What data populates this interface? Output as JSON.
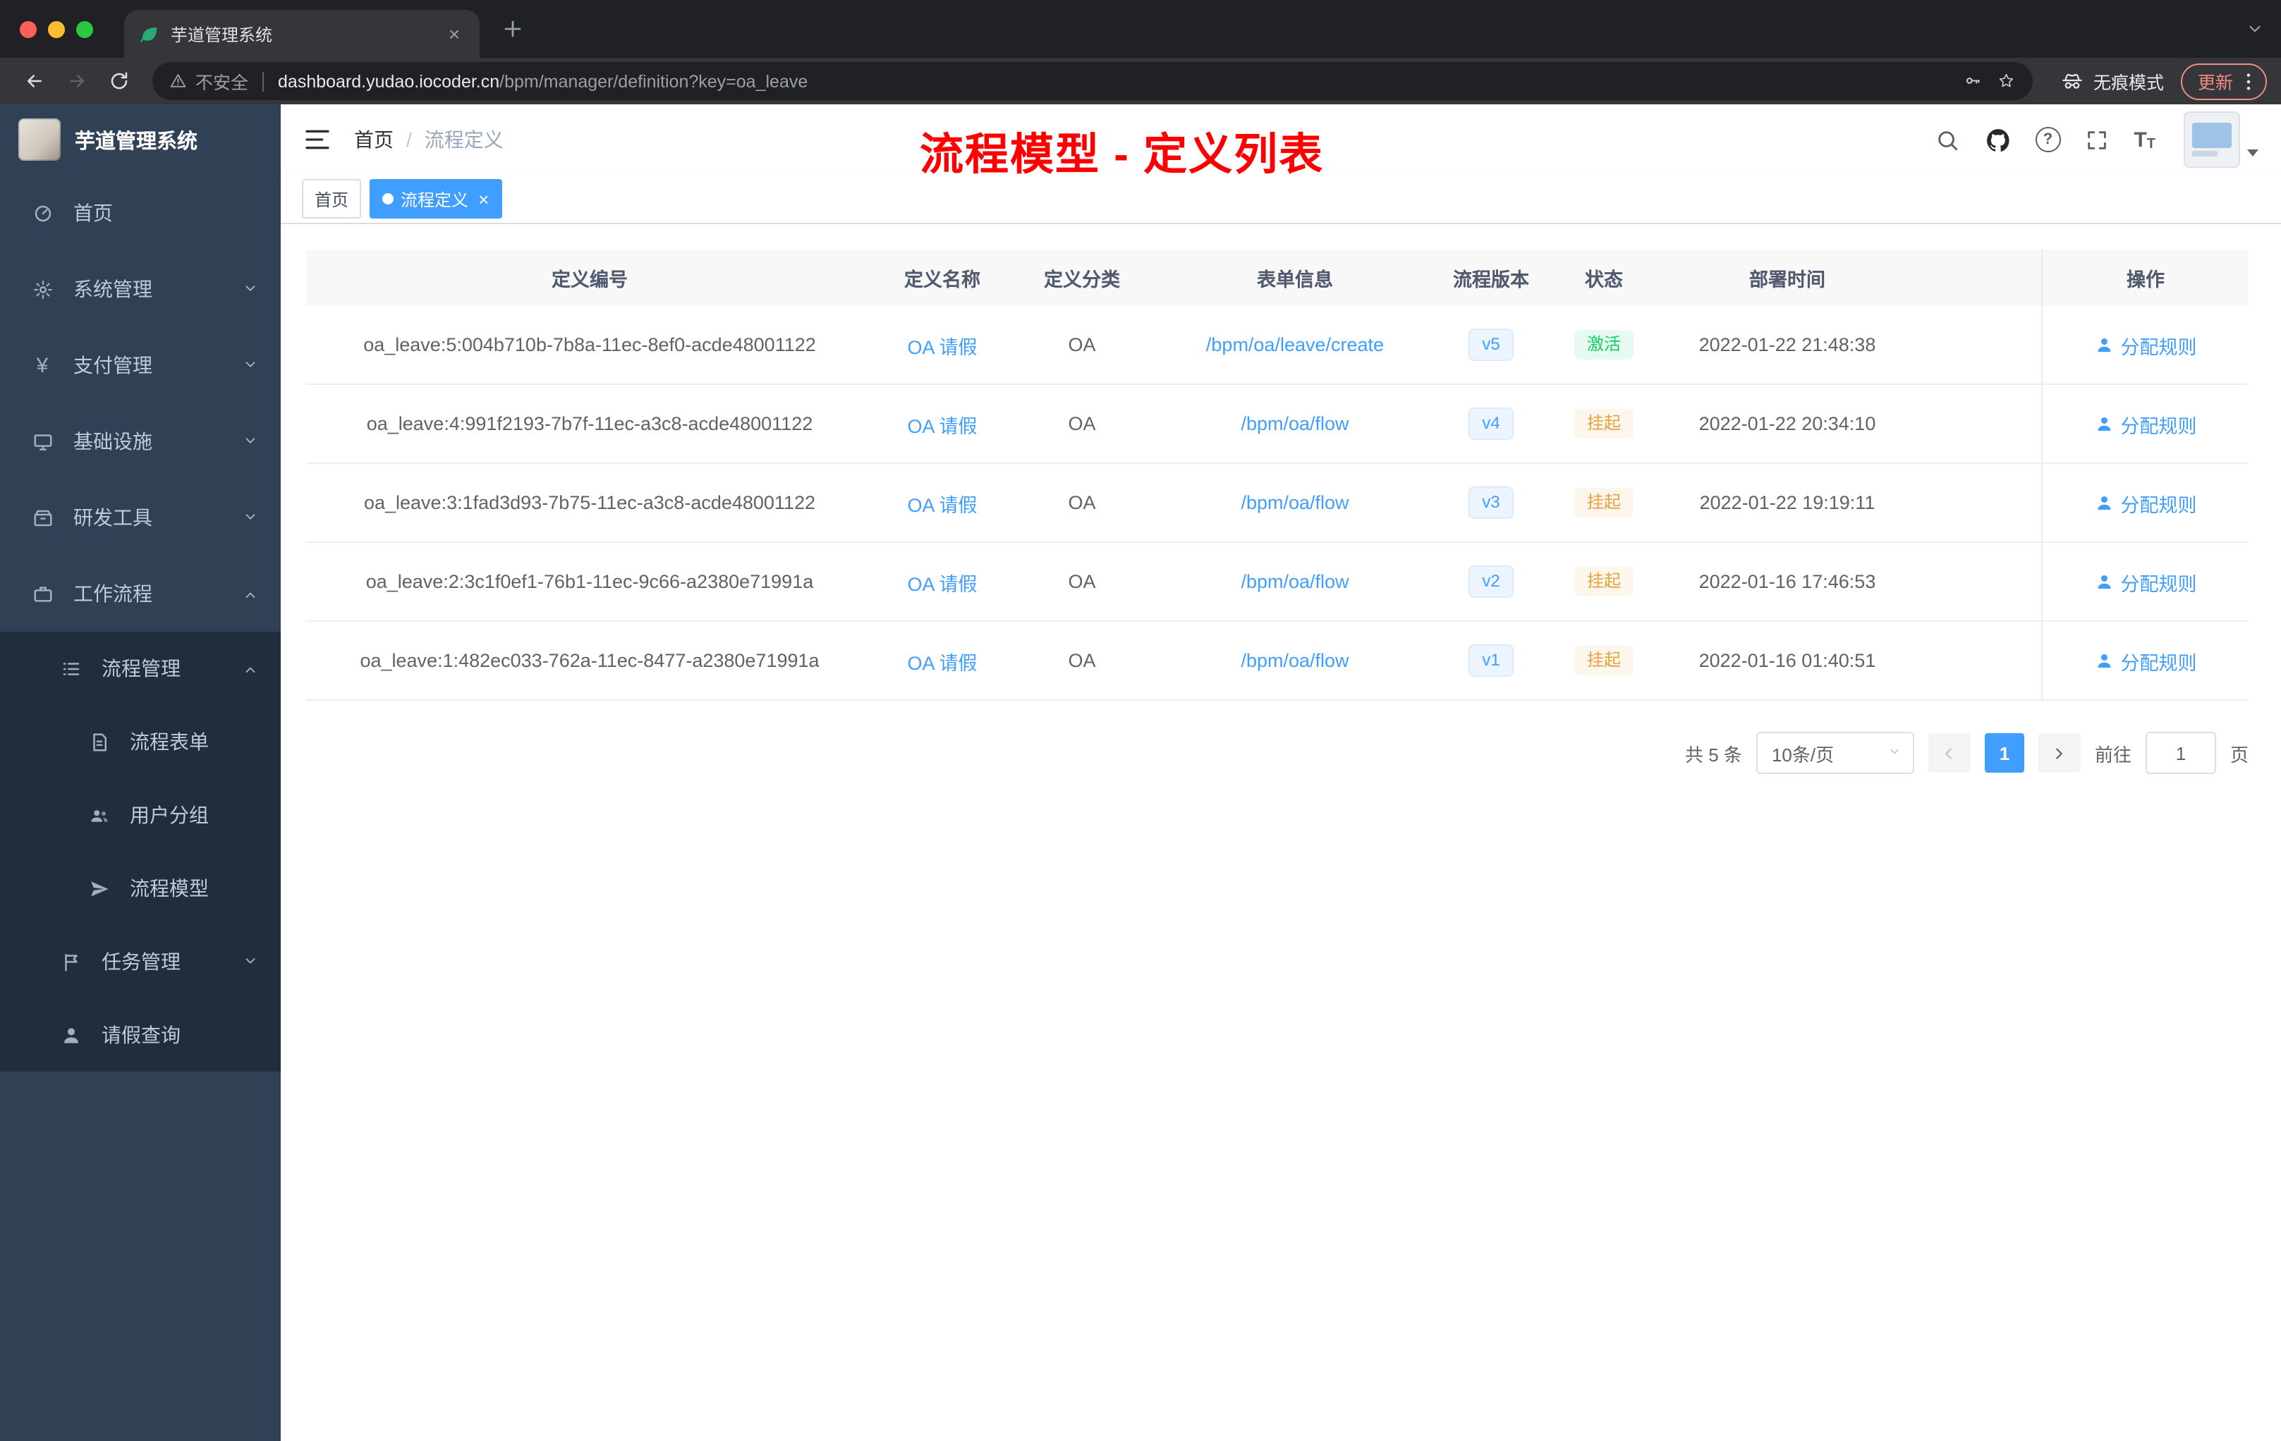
{
  "browser": {
    "tab_title": "芋道管理系统",
    "security_label": "不安全",
    "url_host": "dashboard.yudao.iocoder.cn",
    "url_path": "/bpm/manager/definition?key=oa_leave",
    "incognito_label": "无痕模式",
    "update_label": "更新"
  },
  "sidebar": {
    "logo_title": "芋道管理系统",
    "items": [
      {
        "label": "首页"
      },
      {
        "label": "系统管理"
      },
      {
        "label": "支付管理"
      },
      {
        "label": "基础设施"
      },
      {
        "label": "研发工具"
      },
      {
        "label": "工作流程"
      },
      {
        "label": "流程管理"
      },
      {
        "label": "流程表单"
      },
      {
        "label": "用户分组"
      },
      {
        "label": "流程模型"
      },
      {
        "label": "任务管理"
      },
      {
        "label": "请假查询"
      }
    ]
  },
  "header": {
    "breadcrumb_home": "首页",
    "breadcrumb_separator": "/",
    "breadcrumb_current": "流程定义",
    "annotation": "流程模型 - 定义列表"
  },
  "icons": {
    "help_glyph": "?",
    "font_large": "T",
    "font_small": "T"
  },
  "tags": {
    "home": "首页",
    "active": "流程定义"
  },
  "table": {
    "columns": {
      "id": "定义编号",
      "name": "定义名称",
      "category": "定义分类",
      "form": "表单信息",
      "version": "流程版本",
      "status": "状态",
      "time": "部署时间",
      "action": "操作"
    },
    "rows": [
      {
        "id": "oa_leave:5:004b710b-7b8a-11ec-8ef0-acde48001122",
        "name": "OA 请假",
        "category": "OA",
        "form": "/bpm/oa/leave/create",
        "version": "v5",
        "status": "激活",
        "time": "2022-01-22 21:48:38",
        "action": "分配规则"
      },
      {
        "id": "oa_leave:4:991f2193-7b7f-11ec-a3c8-acde48001122",
        "name": "OA 请假",
        "category": "OA",
        "form": "/bpm/oa/flow",
        "version": "v4",
        "status": "挂起",
        "time": "2022-01-22 20:34:10",
        "action": "分配规则"
      },
      {
        "id": "oa_leave:3:1fad3d93-7b75-11ec-a3c8-acde48001122",
        "name": "OA 请假",
        "category": "OA",
        "form": "/bpm/oa/flow",
        "version": "v3",
        "status": "挂起",
        "time": "2022-01-22 19:19:11",
        "action": "分配规则"
      },
      {
        "id": "oa_leave:2:3c1f0ef1-76b1-11ec-9c66-a2380e71991a",
        "name": "OA 请假",
        "category": "OA",
        "form": "/bpm/oa/flow",
        "version": "v2",
        "status": "挂起",
        "time": "2022-01-16 17:46:53",
        "action": "分配规则"
      },
      {
        "id": "oa_leave:1:482ec033-762a-11ec-8477-a2380e71991a",
        "name": "OA 请假",
        "category": "OA",
        "form": "/bpm/oa/flow",
        "version": "v1",
        "status": "挂起",
        "time": "2022-01-16 01:40:51",
        "action": "分配规则"
      }
    ]
  },
  "pagination": {
    "total": "共 5 条",
    "size": "10条/页",
    "page": "1",
    "goto": "前往",
    "goto_value": "1",
    "unit": "页"
  },
  "colors": {
    "accent": "#409eff",
    "success": "#13ce66",
    "warning": "#e6a23c",
    "sidebar_bg": "#304156",
    "submenu_bg": "#1f2d3d",
    "annotation": "#ff0000"
  }
}
